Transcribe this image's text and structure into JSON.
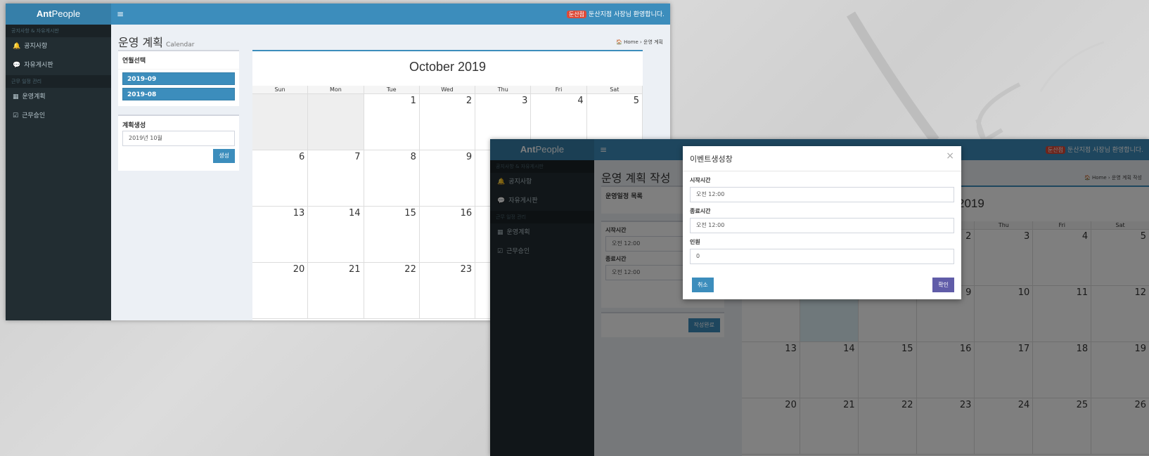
{
  "brand": {
    "name_bold": "Ant",
    "name_rest": "People"
  },
  "header": {
    "badge": "둔산점",
    "welcome": "둔산지점 사장님 환영합니다.",
    "menu_icon": "bars-icon"
  },
  "sidebar": {
    "section1": "공지사항 & 자유게시판",
    "items1": [
      {
        "icon": "bell-icon",
        "label": "공지사항"
      },
      {
        "icon": "comments-icon",
        "label": "자유게시판"
      }
    ],
    "section2": "근무 일정 관리",
    "items2": [
      {
        "icon": "calendar-icon",
        "label": "운영계획"
      },
      {
        "icon": "calendar-check-icon",
        "label": "근무승인"
      }
    ]
  },
  "page1": {
    "title": "운영 계획",
    "subtitle": "Calendar",
    "breadcrumb": [
      "Home",
      "운영 계획"
    ],
    "month_box": {
      "title": "연월선택",
      "months": [
        "2019-09",
        "2019-08"
      ]
    },
    "plan_box": {
      "title": "계획생성",
      "value": "2019년 10월",
      "button": "생성"
    },
    "calendar": {
      "title": "October 2019",
      "weekdays": [
        "Sun",
        "Mon",
        "Tue",
        "Wed",
        "Thu",
        "Fri",
        "Sat"
      ],
      "rows": [
        [
          "",
          "",
          "1",
          "2",
          "3",
          "4",
          "5"
        ],
        [
          "6",
          "7",
          "8",
          "9",
          "",
          "",
          ""
        ],
        [
          "13",
          "14",
          "15",
          "16",
          "",
          "",
          ""
        ],
        [
          "20",
          "21",
          "22",
          "23",
          "",
          "",
          ""
        ]
      ]
    }
  },
  "page2": {
    "title": "운영 계획 작성",
    "breadcrumb": [
      "Home",
      "운영 계획 작성"
    ],
    "list_box": {
      "title": "운영일정 목록"
    },
    "form": {
      "start_label": "시작시간",
      "start_value": "오전 12:00",
      "end_label": "종료시간",
      "end_value": "오전 12:00",
      "done_button": "작성완료"
    },
    "calendar": {
      "title_fragment": "2019",
      "weekdays_visible": [
        "Thu",
        "Fri",
        "Sat"
      ],
      "rows": [
        [
          "2",
          "3",
          "4",
          "5"
        ],
        [
          "9",
          "10",
          "11",
          "12"
        ],
        [
          "13",
          "14",
          "15",
          "16",
          "17",
          "18",
          "19"
        ],
        [
          "20",
          "21",
          "22",
          "23",
          "24",
          "25",
          "26"
        ]
      ]
    }
  },
  "modal": {
    "title": "이벤트생성창",
    "close": "×",
    "start_label": "시작시간",
    "start_value": "오전 12:00",
    "end_label": "종료시간",
    "end_value": "오전 12:00",
    "people_label": "인원",
    "people_value": "0",
    "cancel": "취소",
    "confirm": "확인"
  }
}
